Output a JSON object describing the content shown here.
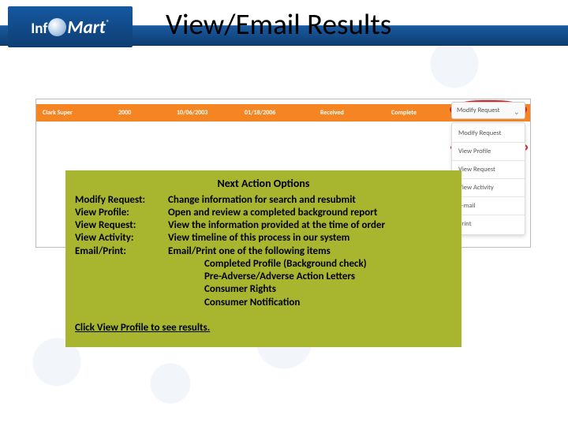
{
  "header": {
    "logo_info": "Inf",
    "logo_mart": "Mart",
    "title": "View/Email Results"
  },
  "data_row": {
    "name": "Clark Super",
    "id": "2000",
    "date1": "10/06/2003",
    "date2": "01/18/2006",
    "status1": "Received",
    "status2": "Complete"
  },
  "dropdown": {
    "selected": "Modify Request",
    "items": [
      "Modify Request",
      "View Profile",
      "View Request",
      "View Activity",
      "E-mail",
      "Print"
    ]
  },
  "info": {
    "title": "Next Action Options",
    "rows": [
      {
        "label": "Modify Request:",
        "desc": "Change information for search and resubmit"
      },
      {
        "label": "View Profile:",
        "desc": "Open and review a completed background report"
      },
      {
        "label": "View Request:",
        "desc": "View the information provided at the time of order"
      },
      {
        "label": "View Activity:",
        "desc": "View timeline of this process in our system"
      },
      {
        "label": "Email/Print:",
        "desc": "Email/Print one of the following items"
      }
    ],
    "subitems": [
      "Completed Profile (Background check)",
      "Pre-Adverse/Adverse Action Letters",
      "Consumer Rights",
      "Consumer Notification"
    ],
    "cta": "Click View Profile to see results."
  }
}
